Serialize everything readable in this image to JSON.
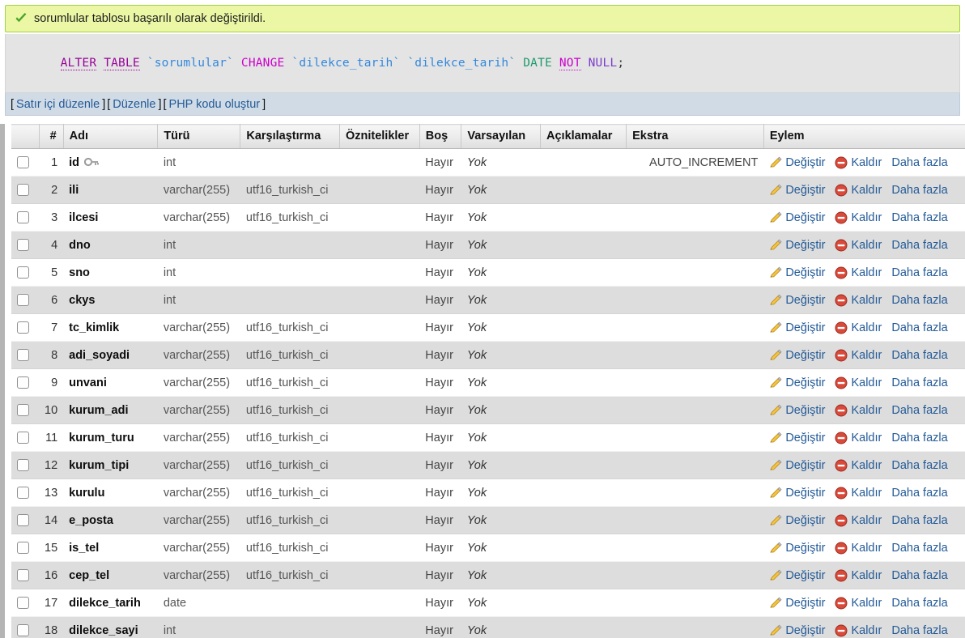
{
  "banner": {
    "icon": "check-success-icon",
    "message": "sorumlular tablosu başarılı olarak değiştirildi."
  },
  "sql": {
    "tokens": [
      {
        "t": "ALTER",
        "k": "alter"
      },
      {
        "t": " ",
        "k": "space"
      },
      {
        "t": "TABLE",
        "k": "alter"
      },
      {
        "t": " ",
        "k": "space"
      },
      {
        "t": "`sorumlular`",
        "k": "ident"
      },
      {
        "t": " ",
        "k": "space"
      },
      {
        "t": "CHANGE",
        "k": "change"
      },
      {
        "t": " ",
        "k": "space"
      },
      {
        "t": "`dilekce_tarih`",
        "k": "ident"
      },
      {
        "t": " ",
        "k": "space"
      },
      {
        "t": "`dilekce_tarih`",
        "k": "ident"
      },
      {
        "t": " ",
        "k": "space"
      },
      {
        "t": "DATE",
        "k": "date"
      },
      {
        "t": " ",
        "k": "space"
      },
      {
        "t": "NOT",
        "k": "not"
      },
      {
        "t": " ",
        "k": "space"
      },
      {
        "t": "NULL",
        "k": "null"
      },
      {
        "t": ";",
        "k": "punc"
      }
    ],
    "plain": "ALTER TABLE `sorumlular` CHANGE `dilekce_tarih` `dilekce_tarih` DATE NOT NULL;"
  },
  "links_bar": {
    "items": [
      {
        "label": "Satır içi düzenle",
        "name": "inline-edit-link"
      },
      {
        "label": "Düzenle",
        "name": "edit-link"
      },
      {
        "label": "PHP kodu oluştur",
        "name": "create-php-code-link"
      }
    ],
    "open_bracket": "[",
    "close_bracket": "]"
  },
  "table": {
    "headers": {
      "checkbox": "",
      "num": "#",
      "name": "Adı",
      "type": "Türü",
      "collation": "Karşılaştırma",
      "attributes": "Öznitelikler",
      "null": "Boş",
      "default": "Varsayılan",
      "comments": "Açıklamalar",
      "extra": "Ekstra",
      "action": "Eylem"
    },
    "action_labels": {
      "change": "Değiştir",
      "drop": "Kaldır",
      "more": "Daha fazla"
    },
    "rows": [
      {
        "num": "1",
        "name": "id",
        "type": "int",
        "collation": "",
        "attributes": "",
        "null": "Hayır",
        "default": "Yok",
        "comments": "",
        "extra": "AUTO_INCREMENT",
        "primary_key": true
      },
      {
        "num": "2",
        "name": "ili",
        "type": "varchar(255)",
        "collation": "utf16_turkish_ci",
        "attributes": "",
        "null": "Hayır",
        "default": "Yok",
        "comments": "",
        "extra": "",
        "primary_key": false
      },
      {
        "num": "3",
        "name": "ilcesi",
        "type": "varchar(255)",
        "collation": "utf16_turkish_ci",
        "attributes": "",
        "null": "Hayır",
        "default": "Yok",
        "comments": "",
        "extra": "",
        "primary_key": false
      },
      {
        "num": "4",
        "name": "dno",
        "type": "int",
        "collation": "",
        "attributes": "",
        "null": "Hayır",
        "default": "Yok",
        "comments": "",
        "extra": "",
        "primary_key": false
      },
      {
        "num": "5",
        "name": "sno",
        "type": "int",
        "collation": "",
        "attributes": "",
        "null": "Hayır",
        "default": "Yok",
        "comments": "",
        "extra": "",
        "primary_key": false
      },
      {
        "num": "6",
        "name": "ckys",
        "type": "int",
        "collation": "",
        "attributes": "",
        "null": "Hayır",
        "default": "Yok",
        "comments": "",
        "extra": "",
        "primary_key": false
      },
      {
        "num": "7",
        "name": "tc_kimlik",
        "type": "varchar(255)",
        "collation": "utf16_turkish_ci",
        "attributes": "",
        "null": "Hayır",
        "default": "Yok",
        "comments": "",
        "extra": "",
        "primary_key": false
      },
      {
        "num": "8",
        "name": "adi_soyadi",
        "type": "varchar(255)",
        "collation": "utf16_turkish_ci",
        "attributes": "",
        "null": "Hayır",
        "default": "Yok",
        "comments": "",
        "extra": "",
        "primary_key": false
      },
      {
        "num": "9",
        "name": "unvani",
        "type": "varchar(255)",
        "collation": "utf16_turkish_ci",
        "attributes": "",
        "null": "Hayır",
        "default": "Yok",
        "comments": "",
        "extra": "",
        "primary_key": false
      },
      {
        "num": "10",
        "name": "kurum_adi",
        "type": "varchar(255)",
        "collation": "utf16_turkish_ci",
        "attributes": "",
        "null": "Hayır",
        "default": "Yok",
        "comments": "",
        "extra": "",
        "primary_key": false
      },
      {
        "num": "11",
        "name": "kurum_turu",
        "type": "varchar(255)",
        "collation": "utf16_turkish_ci",
        "attributes": "",
        "null": "Hayır",
        "default": "Yok",
        "comments": "",
        "extra": "",
        "primary_key": false
      },
      {
        "num": "12",
        "name": "kurum_tipi",
        "type": "varchar(255)",
        "collation": "utf16_turkish_ci",
        "attributes": "",
        "null": "Hayır",
        "default": "Yok",
        "comments": "",
        "extra": "",
        "primary_key": false
      },
      {
        "num": "13",
        "name": "kurulu",
        "type": "varchar(255)",
        "collation": "utf16_turkish_ci",
        "attributes": "",
        "null": "Hayır",
        "default": "Yok",
        "comments": "",
        "extra": "",
        "primary_key": false
      },
      {
        "num": "14",
        "name": "e_posta",
        "type": "varchar(255)",
        "collation": "utf16_turkish_ci",
        "attributes": "",
        "null": "Hayır",
        "default": "Yok",
        "comments": "",
        "extra": "",
        "primary_key": false
      },
      {
        "num": "15",
        "name": "is_tel",
        "type": "varchar(255)",
        "collation": "utf16_turkish_ci",
        "attributes": "",
        "null": "Hayır",
        "default": "Yok",
        "comments": "",
        "extra": "",
        "primary_key": false
      },
      {
        "num": "16",
        "name": "cep_tel",
        "type": "varchar(255)",
        "collation": "utf16_turkish_ci",
        "attributes": "",
        "null": "Hayır",
        "default": "Yok",
        "comments": "",
        "extra": "",
        "primary_key": false
      },
      {
        "num": "17",
        "name": "dilekce_tarih",
        "type": "date",
        "collation": "",
        "attributes": "",
        "null": "Hayır",
        "default": "Yok",
        "comments": "",
        "extra": "",
        "primary_key": false
      },
      {
        "num": "18",
        "name": "dilekce_sayi",
        "type": "int",
        "collation": "",
        "attributes": "",
        "null": "Hayır",
        "default": "Yok",
        "comments": "",
        "extra": "",
        "primary_key": false
      }
    ]
  },
  "colors": {
    "banner_bg": "#ebf7a5",
    "banner_border": "#a2d246",
    "check_green": "#4ba32b",
    "sql_bg": "#e4e4e4",
    "links_bg": "#d0dbe6",
    "link_blue": "#235a97",
    "row_even": "#dddddd",
    "row_odd": "#ffffff",
    "drop_red": "#d94a3a",
    "pencil_yellow": "#f5c242"
  }
}
